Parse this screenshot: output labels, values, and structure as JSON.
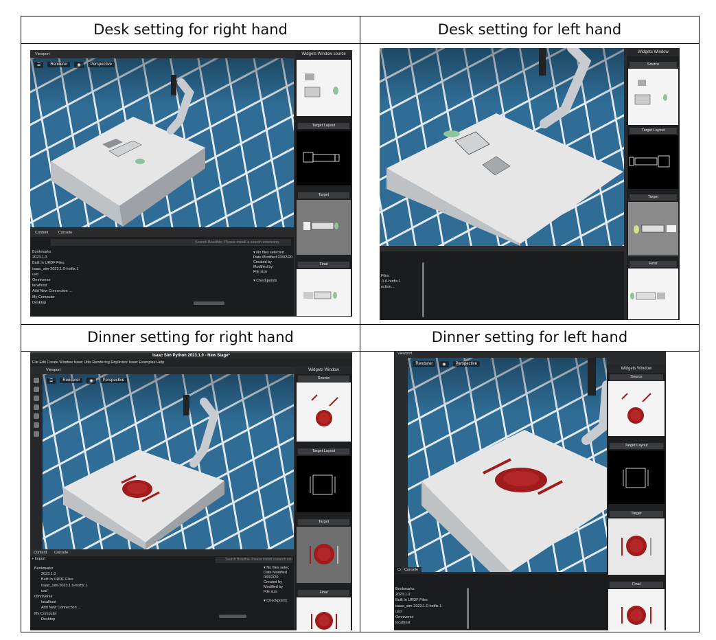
{
  "captions": {
    "top_left": "Desk setting for right hand",
    "top_right": "Desk setting for left hand",
    "bottom_left": "Dinner setting for right hand",
    "bottom_right": "Dinner setting for left hand"
  },
  "app": {
    "window_title": "Isaac Sim Python 2023.1.0 - New Stage*",
    "menu": "File  Edit  Create  Window  Isaac Utils  Rendering  Replicator  Isaac Examples  Help",
    "viewport_tab": "Viewport",
    "renderer_label": "Renderer",
    "perspective_label": "Perspective",
    "widgets_window_title": "Widgets Window",
    "widgets_window_title_alt": "Widgets Window source",
    "section_source": "Source",
    "section_target_layout": "Target Layout",
    "section_target": "Target",
    "section_final": "Final",
    "content_tab": "Content",
    "console_tab": "Console",
    "import_label": "+ Import",
    "search_placeholder": "Search Boudhle: Please install a search extension",
    "no_files": "▾ No files selected",
    "no_files_short": "▾ No files selec",
    "file_info": [
      "Date Modified 03/02/20",
      "Created by",
      "Modified by",
      "File size"
    ],
    "checkpoints": "▾ Checkpoints",
    "tree": [
      "Bookmarks",
      "2023.1.0",
      "Built In URDF Files",
      "isaac_sim-2023.1.0-hotfix.1",
      "usd",
      "Omniverse",
      "localhost",
      "Add New Connection ...",
      "My Computer",
      "Desktop"
    ],
    "tree_fragment": [
      "Files",
      ".1.0-hotfix.1",
      "",
      "",
      "ection..."
    ]
  },
  "colors": {
    "tile_blue": "#2f6d96",
    "grout": "#dfe6ec",
    "table_top": "#e4e4e4",
    "plate_red": "#a01c1c",
    "ui_dark": "#1e1f21"
  }
}
